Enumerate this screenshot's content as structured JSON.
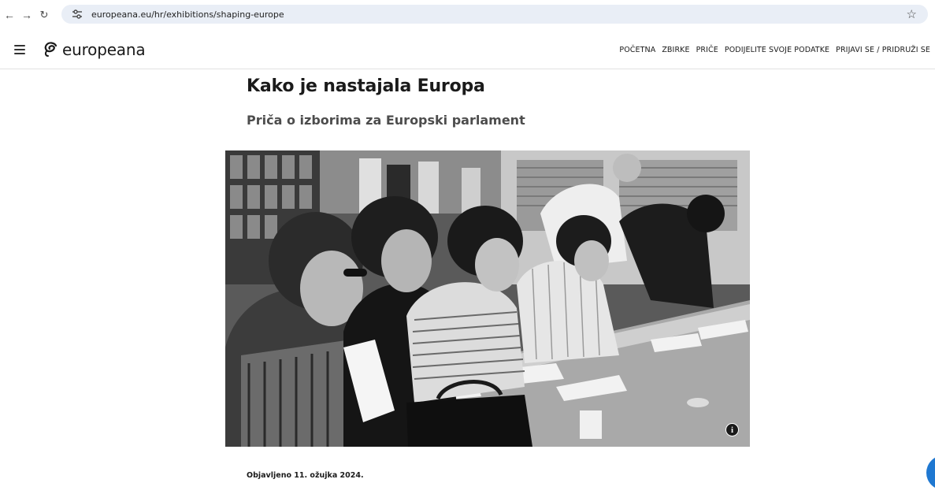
{
  "browser": {
    "url": "europeana.eu/hr/exhibitions/shaping-europe",
    "icons": {
      "back": "arrow-left-icon",
      "forward": "arrow-right-icon",
      "reload": "reload-icon",
      "site_info": "tune-icon",
      "bookmark": "star-icon"
    }
  },
  "header": {
    "logo_text": "europeana",
    "nav": [
      {
        "label": "POČETNA"
      },
      {
        "label": "ZBIRKE"
      },
      {
        "label": "PRIČE"
      },
      {
        "label": "PODIJELITE SVOJE PODATKE"
      },
      {
        "label": "PRIJAVI SE / PRIDRUŽI SE"
      }
    ]
  },
  "article": {
    "title": "Kako je nastajala Europa",
    "subtitle": "Priča o izborima za Europski parlament",
    "info_glyph": "i",
    "published": "Objavljeno 11. ožujka 2024."
  },
  "colors": {
    "url_bar_bg": "#e9eef6",
    "accent_blue": "#1f78d1",
    "text_dark": "#1a1a1a"
  }
}
